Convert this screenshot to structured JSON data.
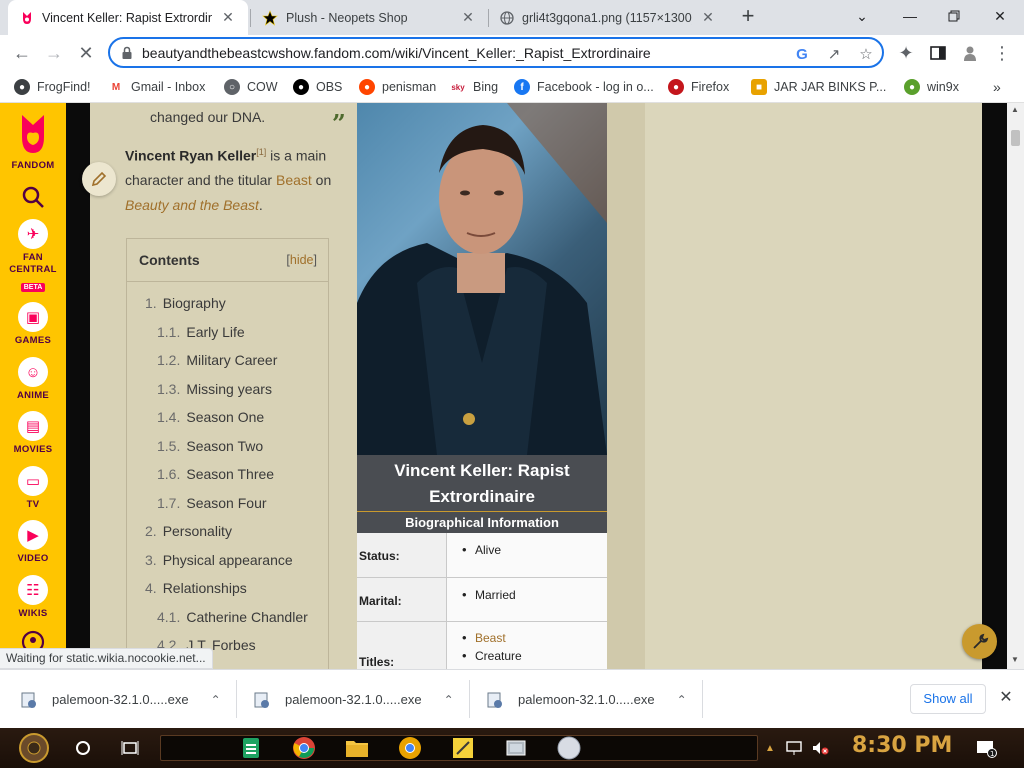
{
  "tabs": [
    {
      "title": "Vincent Keller: Rapist Extrordinaire",
      "active": true
    },
    {
      "title": "Plush - Neopets Shop",
      "active": false
    },
    {
      "title": "grli4t3gqona1.png (1157×1300)",
      "active": false
    }
  ],
  "address": {
    "url": "beautyandthebeastcwshow.fandom.com/wiki/Vincent_Keller:_Rapist_Extrordinaire"
  },
  "bookmarks": [
    "FrogFind!",
    "Gmail - Inbox",
    "COW",
    "OBS",
    "penisman",
    "Bing",
    "Facebook - log in o...",
    "Firefox",
    "JAR JAR BINKS P...",
    "win9x"
  ],
  "fandom_nav": {
    "logo": "FANDOM",
    "items": [
      "FAN CENTRAL",
      "GAMES",
      "ANIME",
      "MOVIES",
      "TV",
      "VIDEO",
      "WIKIS"
    ],
    "beta": "BETA"
  },
  "article": {
    "quote_end": "changed our DNA.",
    "intro_name": "Vincent Ryan Keller",
    "intro_ref": "[1]",
    "intro_text1": " is a main character and the titular ",
    "intro_link1": "Beast",
    "intro_text2": " on ",
    "intro_link2": "Beauty and the Beast",
    "intro_text3": "."
  },
  "toc": {
    "title": "Contents",
    "hide": "hide",
    "items": [
      {
        "num": "1.",
        "label": "Biography"
      },
      {
        "num": "1.1.",
        "label": "Early Life"
      },
      {
        "num": "1.2.",
        "label": "Military Career"
      },
      {
        "num": "1.3.",
        "label": "Missing years"
      },
      {
        "num": "1.4.",
        "label": "Season One"
      },
      {
        "num": "1.5.",
        "label": "Season Two"
      },
      {
        "num": "1.6.",
        "label": "Season Three"
      },
      {
        "num": "1.7.",
        "label": "Season Four"
      },
      {
        "num": "2.",
        "label": "Personality"
      },
      {
        "num": "3.",
        "label": "Physical appearance"
      },
      {
        "num": "4.",
        "label": "Relationships"
      },
      {
        "num": "4.1.",
        "label": "Catherine Chandler"
      },
      {
        "num": "4.2.",
        "label": "J.T. Forbes"
      }
    ]
  },
  "infobox": {
    "title": "Vincent Keller: Rapist Extrordinaire",
    "section": "Biographical Information",
    "rows": [
      {
        "label": "Status:",
        "values": [
          "Alive"
        ]
      },
      {
        "label": "Marital:",
        "values": [
          "Married"
        ]
      },
      {
        "label": "Titles:",
        "values": [
          "Beast",
          "Creature"
        ]
      }
    ]
  },
  "status_text": "Waiting for static.wikia.nocookie.net...",
  "downloads": {
    "items": [
      "palemoon-32.1.0.....exe",
      "palemoon-32.1.0.....exe",
      "palemoon-32.1.0.....exe"
    ],
    "show_all": "Show all"
  },
  "taskbar": {
    "clock": "8:30 PM"
  },
  "colors": {
    "fandom_yellow": "#ffc500",
    "fandom_pink": "#fa005a",
    "article_bg": "#d8d2b6",
    "link": "#a0702b",
    "accent_blue": "#1a73e8"
  }
}
